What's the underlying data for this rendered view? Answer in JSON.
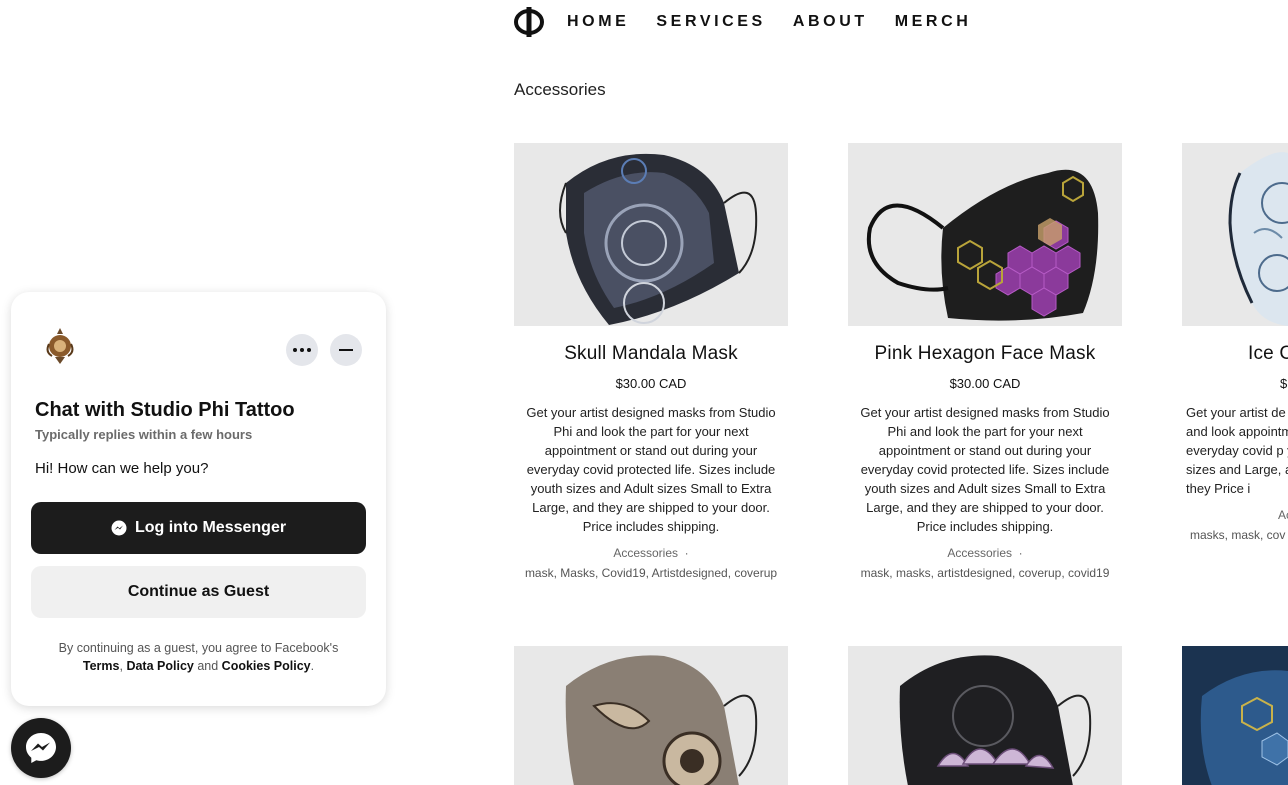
{
  "nav": {
    "items": [
      "HOME",
      "SERVICES",
      "ABOUT",
      "MERCH"
    ]
  },
  "category_title": "Accessories",
  "products": [
    {
      "name": "Skull Mandala Mask",
      "price": "$30.00 CAD",
      "description": "Get your artist designed masks from Studio Phi and look the part for your next appointment or stand out during your everyday covid protected life. Sizes include youth sizes and Adult sizes Small to Extra Large, and they are shipped to your door. Price includes shipping.",
      "category": "Accessories",
      "tags": "mask, Masks, Covid19, Artistdesigned, coverup",
      "image_icon": "skull-mandala-mask-image"
    },
    {
      "name": "Pink Hexagon Face Mask",
      "price": "$30.00 CAD",
      "description": "Get your artist designed masks from Studio Phi and look the part for your next appointment or stand out during your everyday covid protected life. Sizes include youth sizes and Adult sizes Small to Extra Large, and they are shipped to your door. Price includes shipping.",
      "category": "Accessories",
      "tags": "mask, masks, artistdesigned, coverup, covid19",
      "image_icon": "pink-hexagon-mask-image"
    },
    {
      "name": "Ice C",
      "price": "$",
      "description": "Get your artist de Phi and look appointment c everyday covid p youth sizes and Large, and they Price i",
      "category": "Ac",
      "tags": "masks, mask, cov",
      "image_icon": "ice-mask-image"
    }
  ],
  "chat": {
    "title": "Chat with Studio Phi Tattoo",
    "subtitle": "Typically replies within a few hours",
    "greeting": "Hi! How can we help you?",
    "login_label": "Log into Messenger",
    "guest_label": "Continue as Guest",
    "legal_prefix": "By continuing as a guest, you agree to Facebook's",
    "legal_terms": "Terms",
    "legal_comma": ",",
    "legal_data": "Data Policy",
    "legal_and": "and",
    "legal_cookies": "Cookies Policy",
    "legal_period": "."
  },
  "colors": {
    "messenger_dark": "#1c1c1c",
    "thumb_bg": "#e6e6e6",
    "hex_purple": "#8b3a9b"
  }
}
